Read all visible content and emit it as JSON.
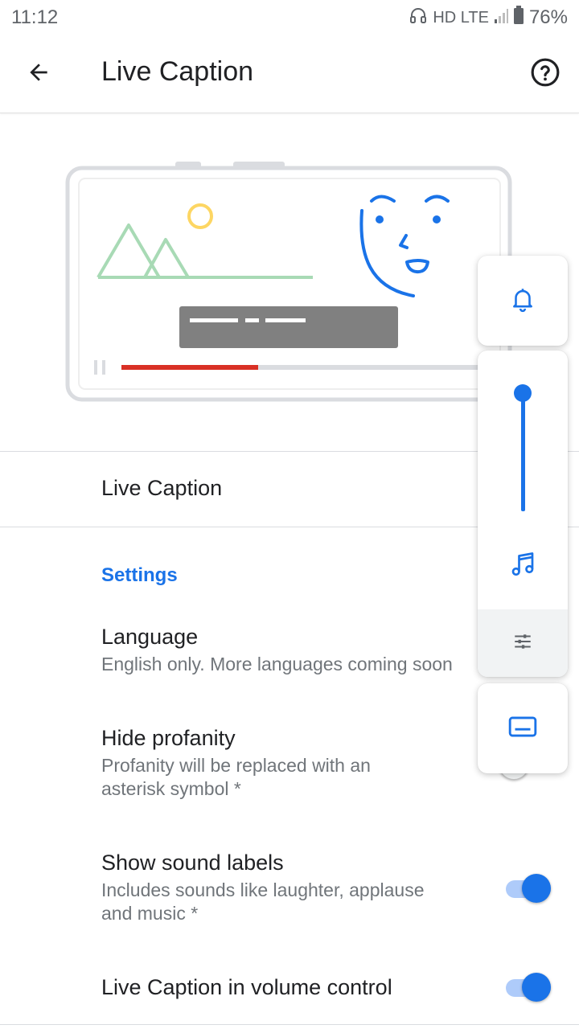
{
  "status_bar": {
    "time": "11:12",
    "network": "HD LTE",
    "battery": "76%"
  },
  "app_bar": {
    "title": "Live Caption",
    "back_icon": "arrow-back-icon",
    "help_icon": "help-circle-icon"
  },
  "main_toggle": {
    "label": "Live Caption"
  },
  "settings": {
    "header": "Settings",
    "items": [
      {
        "title": "Language",
        "summary": "English only. More languages coming soon"
      },
      {
        "title": "Hide profanity",
        "summary": "Profanity will be replaced with an\nasterisk symbol *",
        "checked": false
      },
      {
        "title": "Show sound labels",
        "summary": "Includes sounds like laughter, applause\nand music *",
        "checked": true
      },
      {
        "title": "Live Caption in volume control",
        "checked": true
      }
    ]
  },
  "volume_panel": {
    "icons": [
      "bell-icon",
      "music-note-icon",
      "sliders-icon",
      "captions-icon"
    ],
    "volume_level": 1.0
  },
  "colors": {
    "accent": "#1a73e8",
    "progress_red": "#d93025",
    "mountain_green": "#a8dab5",
    "sun_yellow": "#fdd663"
  }
}
